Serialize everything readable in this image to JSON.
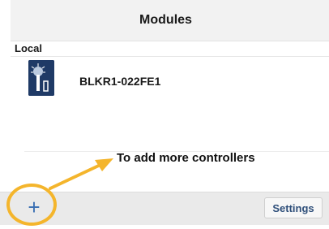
{
  "header": {
    "title": "Modules"
  },
  "section": {
    "label": "Local"
  },
  "modules": [
    {
      "name": "BLKR1-022FE1",
      "icon": "controller-icon"
    }
  ],
  "annotation": {
    "text": "To add more controllers",
    "color": "#f4b52c"
  },
  "toolbar": {
    "add_label": "+",
    "settings_label": "Settings"
  }
}
